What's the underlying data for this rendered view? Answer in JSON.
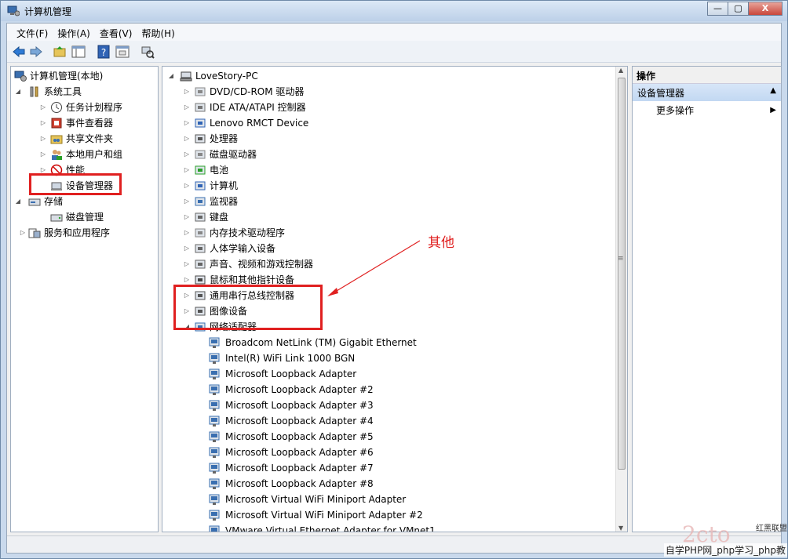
{
  "window": {
    "title": "计算机管理",
    "buttons": {
      "minimize": "—",
      "maximize": "▢",
      "close": "X"
    }
  },
  "menu": [
    {
      "label": "文件(F)"
    },
    {
      "label": "操作(A)"
    },
    {
      "label": "查看(V)"
    },
    {
      "label": "帮助(H)"
    }
  ],
  "toolbar": {
    "icons": [
      "back-arrow-icon",
      "forward-arrow-icon",
      "up-folder-icon",
      "show-hide-tree-icon",
      "help-icon",
      "properties-icon",
      "scan-hardware-icon"
    ]
  },
  "left_tree": {
    "root": "计算机管理(本地)",
    "system_tools": "系统工具",
    "items": [
      "任务计划程序",
      "事件查看器",
      "共享文件夹",
      "本地用户和组",
      "性能",
      "设备管理器"
    ],
    "storage": "存储",
    "disk_management": "磁盘管理",
    "services": "服务和应用程序"
  },
  "device_tree": {
    "computer": "LoveStory-PC",
    "categories": [
      "DVD/CD-ROM 驱动器",
      "IDE ATA/ATAPI 控制器",
      "Lenovo RMCT Device",
      "处理器",
      "磁盘驱动器",
      "电池",
      "计算机",
      "监视器",
      "键盘",
      "内存技术驱动程序",
      "人体学输入设备",
      "声音、视频和游戏控制器",
      "鼠标和其他指针设备",
      "通用串行总线控制器",
      "图像设备",
      "网络适配器"
    ],
    "network_adapters": [
      "Broadcom NetLink (TM) Gigabit Ethernet",
      "Intel(R) WiFi Link 1000 BGN",
      "Microsoft Loopback Adapter",
      "Microsoft Loopback Adapter #2",
      "Microsoft Loopback Adapter #3",
      "Microsoft Loopback Adapter #4",
      "Microsoft Loopback Adapter #5",
      "Microsoft Loopback Adapter #6",
      "Microsoft Loopback Adapter #7",
      "Microsoft Loopback Adapter #8",
      "Microsoft Virtual WiFi Miniport Adapter",
      "Microsoft Virtual WiFi Miniport Adapter #2",
      "VMware Virtual Ethernet Adapter for VMnet1"
    ]
  },
  "actions": {
    "header": "操作",
    "section": "设备管理器",
    "more": "更多操作"
  },
  "annotation": {
    "text": "其他",
    "color": "#e02020"
  },
  "watermark": {
    "top": "红黑联盟",
    "bottom": "自学PHP网_php学习_php教"
  }
}
